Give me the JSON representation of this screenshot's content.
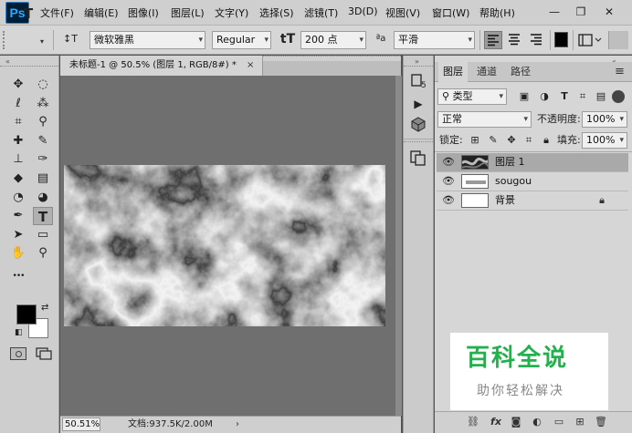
{
  "app": {
    "logo": "Ps"
  },
  "menu": {
    "items": [
      "文件(F)",
      "编辑(E)",
      "图像(I)",
      "图层(L)",
      "文字(Y)",
      "选择(S)",
      "滤镜(T)",
      "3D(D)",
      "视图(V)",
      "窗口(W)",
      "帮助(H)"
    ],
    "window_controls": {
      "minimize": "—",
      "restore": "❐",
      "close": "✕"
    }
  },
  "options_bar": {
    "tool_icon": "T",
    "orientation_icon": "↕T",
    "font_family": "微软雅黑",
    "font_style": "Regular",
    "size_icon": "tT",
    "font_size": "200 点",
    "aa_label": "ªa",
    "anti_alias": "平滑",
    "align_icons": [
      "align-left-icon",
      "align-center-icon",
      "align-right-icon"
    ],
    "text_color": "#000000"
  },
  "document": {
    "tab_title": "未标题-1 @ 50.5% (图层 1, RGB/8#) *",
    "tab_close": "×",
    "zoom": "50.51%",
    "doc_info": "文档:937.5K/2.00M",
    "status_arrow": "›"
  },
  "toolbar": {
    "tools": [
      {
        "name": "move-tool",
        "glyph": "✥"
      },
      {
        "name": "marquee-tool",
        "glyph": "◌"
      },
      {
        "name": "lasso-tool",
        "glyph": "ℓ"
      },
      {
        "name": "magic-wand-tool",
        "glyph": "⁂"
      },
      {
        "name": "crop-tool",
        "glyph": "⌗"
      },
      {
        "name": "eyedropper-tool",
        "glyph": "⚲"
      },
      {
        "name": "healing-brush-tool",
        "glyph": "✚"
      },
      {
        "name": "brush-tool",
        "glyph": "✎"
      },
      {
        "name": "clone-stamp-tool",
        "glyph": "⊥"
      },
      {
        "name": "history-brush-tool",
        "glyph": "✑"
      },
      {
        "name": "eraser-tool",
        "glyph": "◆"
      },
      {
        "name": "gradient-tool",
        "glyph": "▤"
      },
      {
        "name": "blur-tool",
        "glyph": "◔"
      },
      {
        "name": "dodge-tool",
        "glyph": "◕"
      },
      {
        "name": "pen-tool",
        "glyph": "✒"
      },
      {
        "name": "type-tool",
        "glyph": "T"
      },
      {
        "name": "path-selection-tool",
        "glyph": "➤"
      },
      {
        "name": "rectangle-tool",
        "glyph": "▭"
      },
      {
        "name": "hand-tool",
        "glyph": "✋"
      },
      {
        "name": "zoom-tool",
        "glyph": "⚲"
      },
      {
        "name": "more-tools",
        "glyph": "•••"
      }
    ],
    "foreground_color": "#000000",
    "background_color": "#ffffff"
  },
  "panel": {
    "tabs": [
      "图层",
      "通道",
      "路径"
    ],
    "filter_type": "类型",
    "blend_mode": "正常",
    "opacity_label": "不透明度:",
    "opacity": "100%",
    "lock_label": "锁定:",
    "fill_label": "填充:",
    "fill": "100%",
    "layers": [
      {
        "name": "图层 1",
        "selected": true,
        "locked": false
      },
      {
        "name": "sougou",
        "selected": false,
        "locked": false
      },
      {
        "name": "背景",
        "selected": false,
        "locked": true
      }
    ],
    "menu_icon": "≡"
  },
  "watermark": {
    "title": "百科全说",
    "subtitle": "助你轻松解决"
  }
}
